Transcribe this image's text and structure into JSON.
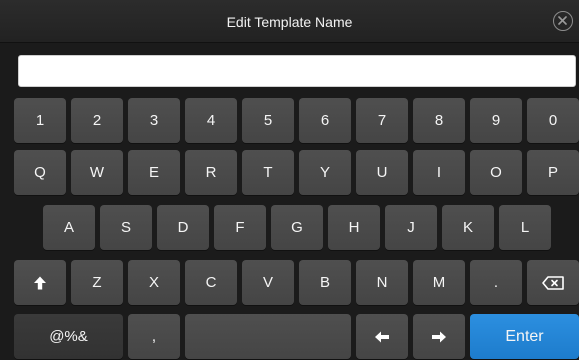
{
  "dialog": {
    "title": "Edit Template Name",
    "input_value": "",
    "close_icon": "close-circle-icon"
  },
  "keyboard": {
    "row1": [
      "1",
      "2",
      "3",
      "4",
      "5",
      "6",
      "7",
      "8",
      "9",
      "0"
    ],
    "row2": [
      "Q",
      "W",
      "E",
      "R",
      "T",
      "Y",
      "U",
      "I",
      "O",
      "P"
    ],
    "row3": [
      "A",
      "S",
      "D",
      "F",
      "G",
      "H",
      "J",
      "K",
      "L"
    ],
    "row4": [
      "Z",
      "X",
      "C",
      "V",
      "B",
      "N",
      "M",
      "."
    ],
    "shift_icon": "shift-arrow-up-icon",
    "backspace_icon": "backspace-icon",
    "symbols_label": "@%&",
    "comma_label": ",",
    "left_arrow_icon": "arrow-left-icon",
    "right_arrow_icon": "arrow-right-icon",
    "enter_label": "Enter"
  },
  "colors": {
    "background": "#1b1b1b",
    "key": "#4a4a4a",
    "enter": "#2486d6"
  }
}
